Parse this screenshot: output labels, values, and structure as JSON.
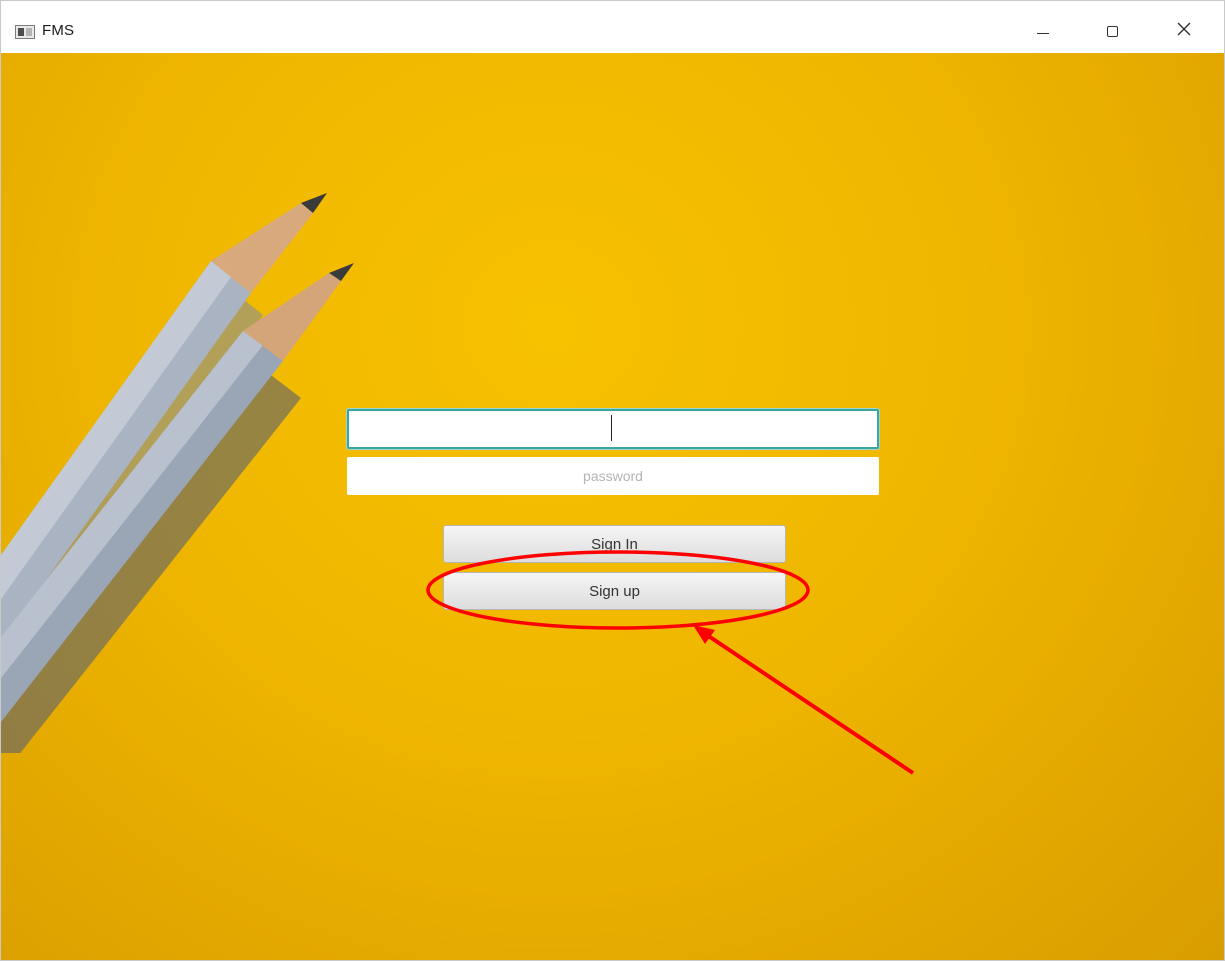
{
  "window": {
    "title": "FMS",
    "controls": {
      "minimize": "minimize-icon",
      "maximize": "maximize-icon",
      "close": "close-icon"
    }
  },
  "login": {
    "username_value": "",
    "password_placeholder": "password",
    "sign_in_label": "Sign In",
    "sign_up_label": "Sign up"
  },
  "colors": {
    "background": "#f0b800",
    "focus_ring": "#3aa6a0",
    "annotation": "#ff0000"
  }
}
